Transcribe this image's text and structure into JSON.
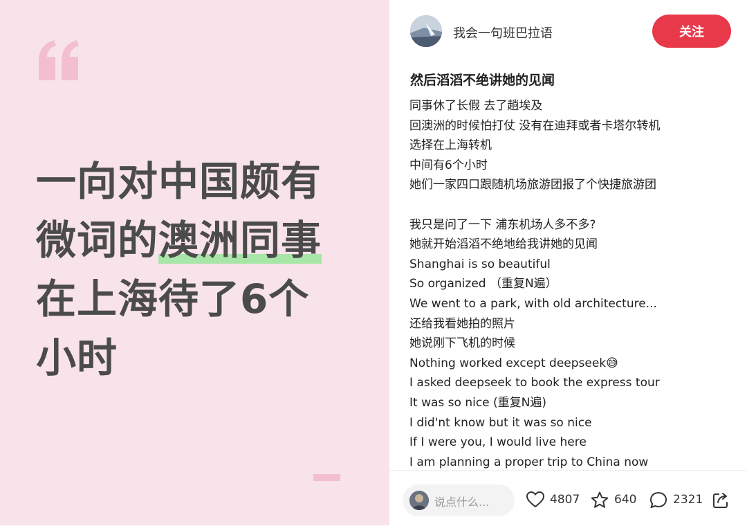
{
  "cover": {
    "hero_lines": [
      {
        "before": "一向对中国颇有",
        "highlight": "",
        "after": ""
      },
      {
        "before": "微词的",
        "highlight": "澳洲同事",
        "after": ""
      },
      {
        "before": "在上海待了6个",
        "highlight": "",
        "after": ""
      },
      {
        "before": "小时",
        "highlight": "",
        "after": ""
      }
    ],
    "highlight_color": "#a8e6a8",
    "background": "#f8e3ea"
  },
  "header": {
    "author_name": "我会一句班巴拉语",
    "follow_label": "关注",
    "follow_color": "#e8394a"
  },
  "post": {
    "title": "然后滔滔不绝讲她的见闻",
    "lines": [
      "同事休了长假 去了趟埃及",
      "回澳洲的时候怕打仗 没有在迪拜或者卡塔尔转机",
      "选择在上海转机",
      "中间有6个小时",
      "她们一家四口跟随机场旅游团报了个快捷旅游团",
      "",
      "我只是问了一下 浦东机场人多不多?",
      "她就开始滔滔不绝地给我讲她的见闻",
      "Shanghai is so beautiful",
      "So organized （重复N遍）",
      "We went to a park, with old architecture...",
      "还给我看她拍的照片",
      "她说刚下飞机的时候",
      "Nothing worked except deepseek😅",
      "I asked deepseek to book the express tour",
      "It was so nice (重复N遍)",
      "I did'nt know but it was so nice",
      "If I were you, I would live here",
      "I am planning a proper trip to China now"
    ]
  },
  "footer": {
    "comment_placeholder": "说点什么...",
    "likes": "4807",
    "stars": "640",
    "comments": "2321",
    "icons": [
      "heart-icon",
      "star-icon",
      "comment-icon",
      "share-icon"
    ]
  }
}
